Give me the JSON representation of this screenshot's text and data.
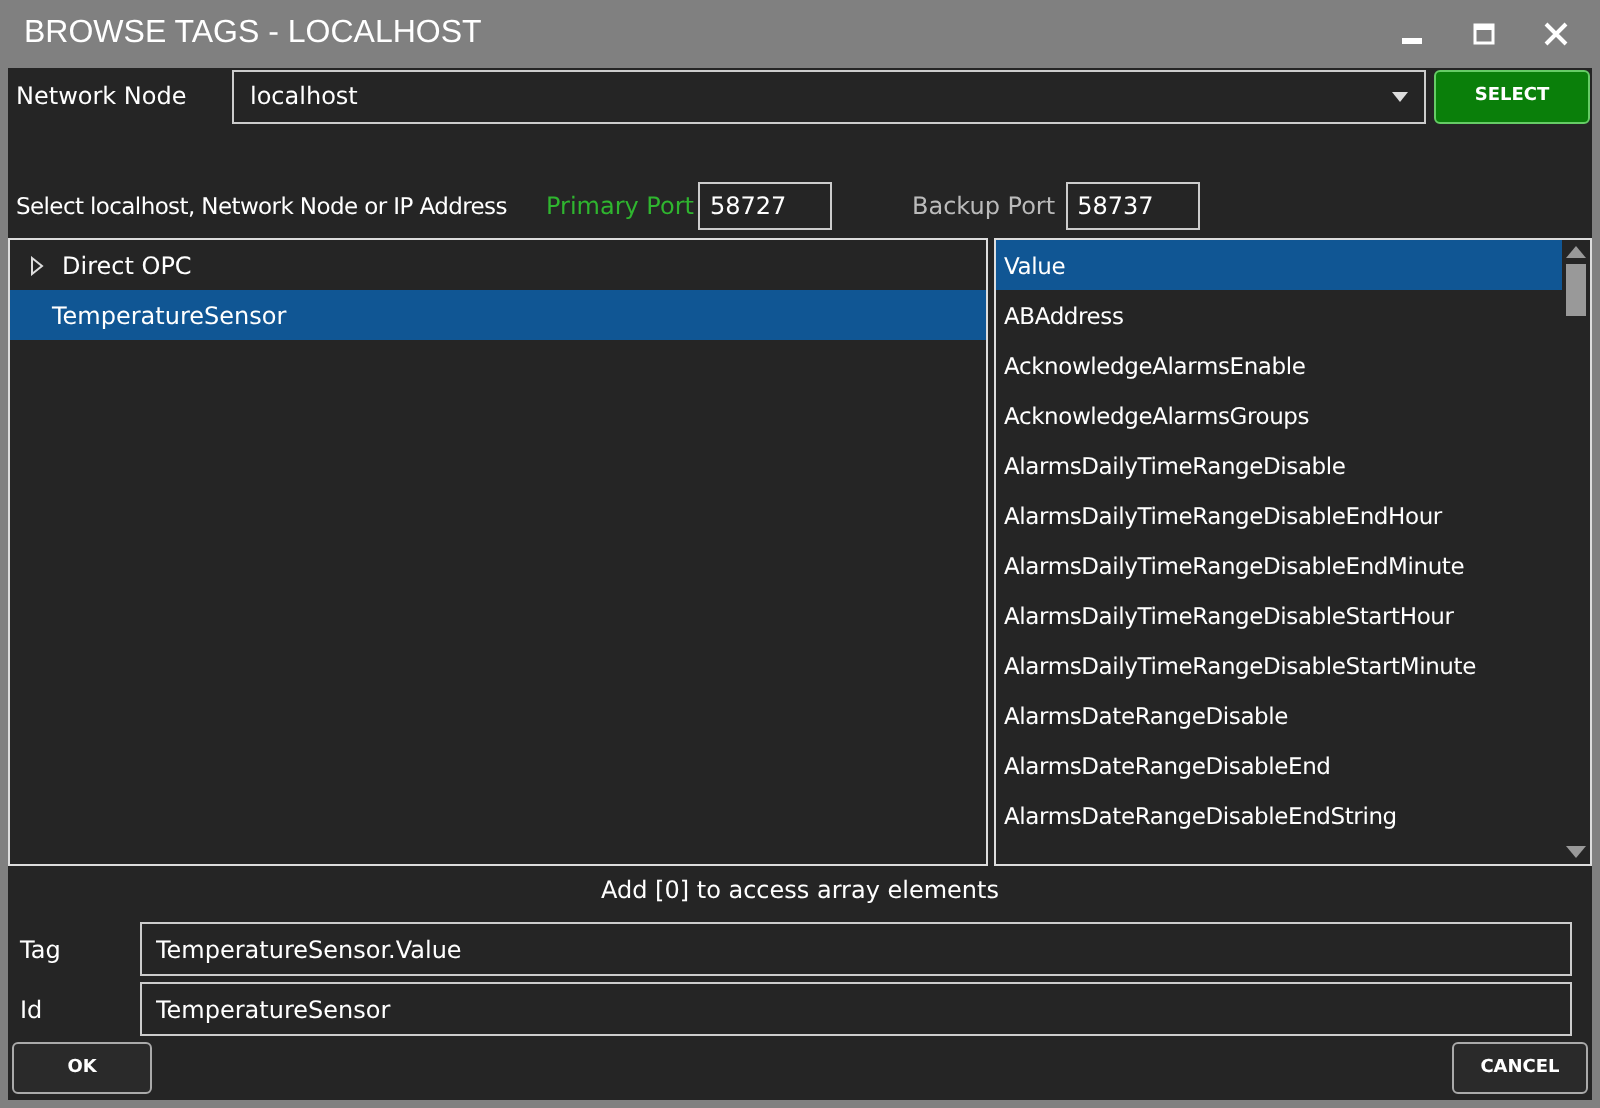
{
  "window": {
    "title": "BROWSE TAGS - LOCALHOST"
  },
  "network_node": {
    "label": "Network Node",
    "value": "localhost",
    "select_button": "SELECT"
  },
  "ports": {
    "hint": "Select localhost, Network Node or IP Address",
    "primary_label": "Primary Port",
    "primary_value": "58727",
    "backup_label": "Backup Port",
    "backup_value": "58737"
  },
  "tree": [
    {
      "label": "Direct OPC",
      "kind": "group",
      "expanded": false,
      "selected": false
    },
    {
      "label": "TemperatureSensor",
      "kind": "item",
      "selected": true
    }
  ],
  "tag_list": [
    {
      "label": "Value",
      "selected": true
    },
    {
      "label": "ABAddress",
      "selected": false
    },
    {
      "label": "AcknowledgeAlarmsEnable",
      "selected": false
    },
    {
      "label": "AcknowledgeAlarmsGroups",
      "selected": false
    },
    {
      "label": "AlarmsDailyTimeRangeDisable",
      "selected": false
    },
    {
      "label": "AlarmsDailyTimeRangeDisableEndHour",
      "selected": false
    },
    {
      "label": "AlarmsDailyTimeRangeDisableEndMinute",
      "selected": false
    },
    {
      "label": "AlarmsDailyTimeRangeDisableStartHour",
      "selected": false
    },
    {
      "label": "AlarmsDailyTimeRangeDisableStartMinute",
      "selected": false
    },
    {
      "label": "AlarmsDateRangeDisable",
      "selected": false
    },
    {
      "label": "AlarmsDateRangeDisableEnd",
      "selected": false
    },
    {
      "label": "AlarmsDateRangeDisableEndString",
      "selected": false
    }
  ],
  "array_hint": "Add [0] to access array elements",
  "fields": [
    {
      "label": "Tag",
      "value": "TemperatureSensor.Value"
    },
    {
      "label": "Id",
      "value": "TemperatureSensor"
    }
  ],
  "buttons": {
    "ok": "OK",
    "cancel": "CANCEL"
  }
}
